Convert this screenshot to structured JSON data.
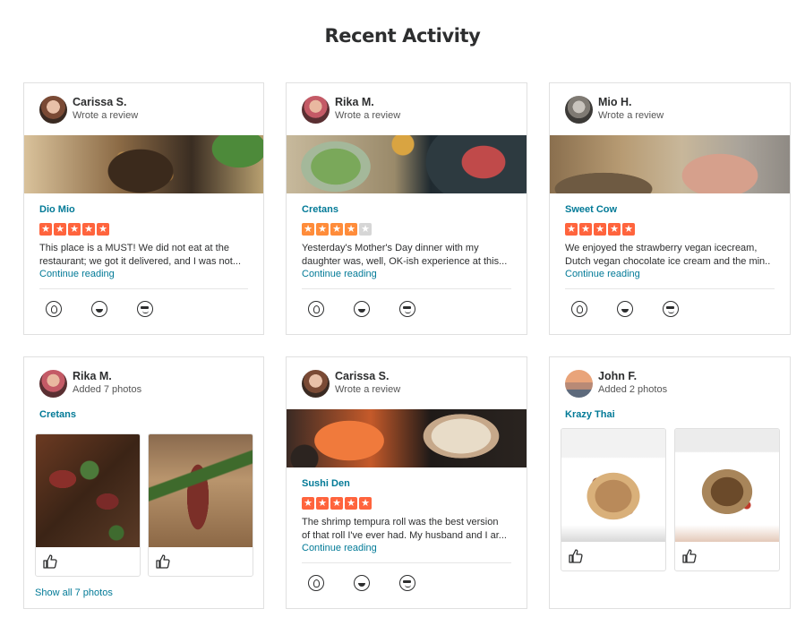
{
  "page": {
    "title": "Recent Activity"
  },
  "cards": [
    {
      "user": "Carissa S.",
      "action": "Wrote a review",
      "business": "Dio Mio",
      "rating": 5,
      "snippet_line1": "This place is a MUST! We did not eat at the",
      "snippet_line2": "restaurant; we got it delivered, and I was not...",
      "link": "Continue reading"
    },
    {
      "user": "Rika M.",
      "action": "Wrote a review",
      "business": "Cretans",
      "rating": 4,
      "snippet_line1": "Yesterday's Mother's Day dinner with my",
      "snippet_line2": "daughter was, well, OK-ish experience at this...",
      "link": "Continue reading"
    },
    {
      "user": "Mio H.",
      "action": "Wrote a review",
      "business": "Sweet Cow",
      "rating": 5,
      "snippet_line1": "We enjoyed the strawberry vegan icecream,",
      "snippet_line2": "Dutch vegan chocolate ice cream and the min...",
      "link": "Continue reading"
    },
    {
      "user": "Rika M.",
      "action": "Added 7 photos",
      "business": "Cretans",
      "link": "Show all 7 photos"
    },
    {
      "user": "Carissa S.",
      "action": "Wrote a review",
      "business": "Sushi Den",
      "rating": 5,
      "snippet_line1": "The shrimp tempura roll was the best version",
      "snippet_line2": "of that roll I've ever had. My husband and I ar...",
      "link": "Continue reading"
    },
    {
      "user": "John F.",
      "action": "Added 2 photos",
      "business": "Krazy Thai"
    }
  ],
  "icons": {
    "reactions": [
      "useful-icon",
      "funny-icon",
      "cool-icon"
    ],
    "like": "thumbs-up-icon",
    "star": "star-icon"
  },
  "colors": {
    "link": "#027a97",
    "star_red": "#ff643d",
    "star_orange": "#ff8c3a",
    "star_off": "#d6d6d6"
  }
}
